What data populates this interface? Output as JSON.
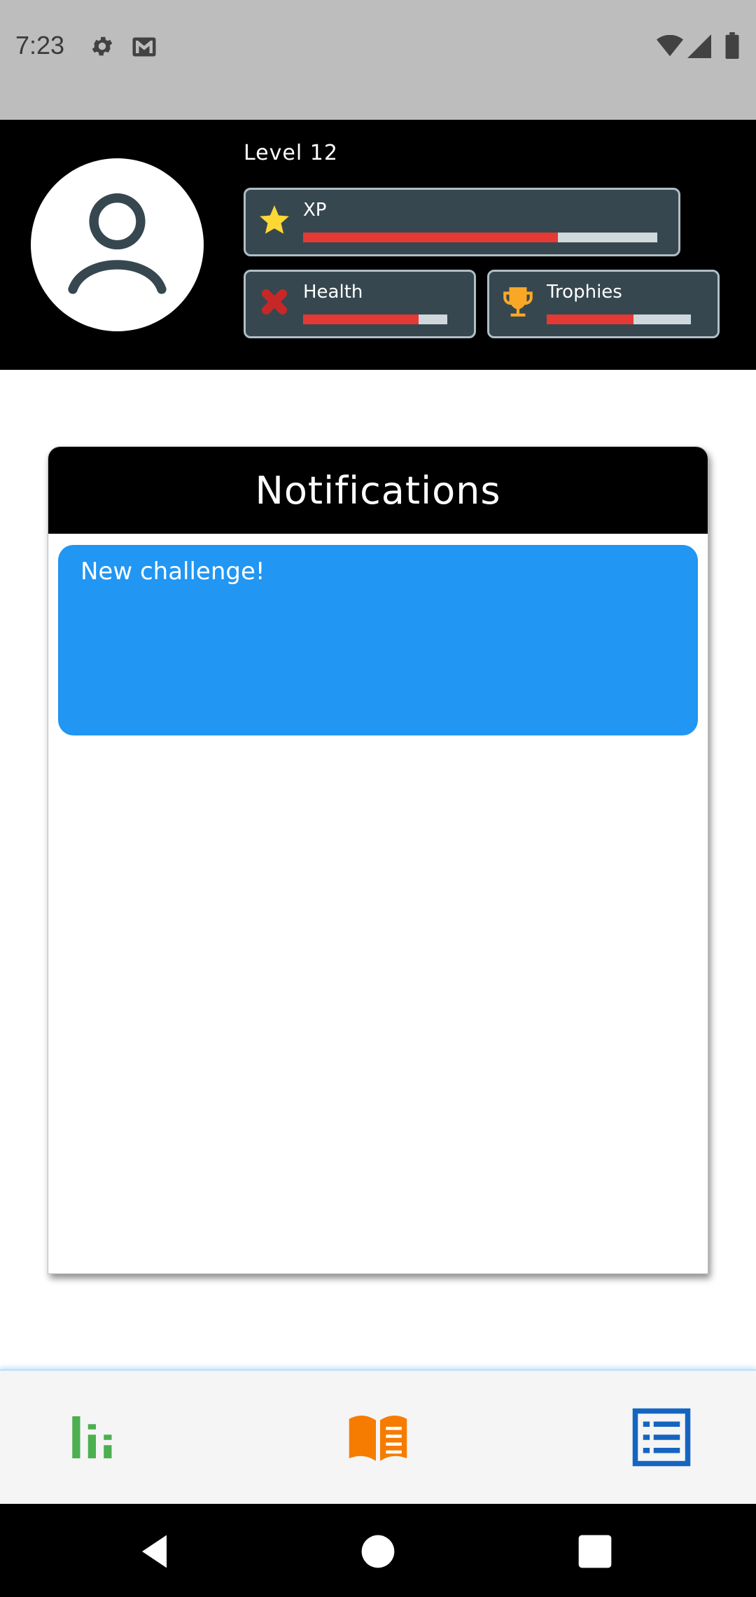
{
  "status_bar": {
    "time": "7:23",
    "icons": [
      "gear-icon",
      "gmail-icon",
      "wifi-icon",
      "signal-icon",
      "battery-icon"
    ]
  },
  "profile": {
    "avatar_icon": "person-icon",
    "level_text": "Level 12",
    "stats": {
      "xp": {
        "label": "XP",
        "icon": "star-icon",
        "fill": 0.72
      },
      "health": {
        "label": "Health",
        "icon": "bandage-icon",
        "fill": 0.8
      },
      "trophies": {
        "label": "Trophies",
        "icon": "trophy-icon",
        "fill": 0.6
      }
    }
  },
  "notifications": {
    "title": "Notifications",
    "items": [
      {
        "text": "New challenge!"
      }
    ]
  },
  "bottom_nav": {
    "items": [
      "stats-chart-icon",
      "book-icon",
      "list-icon"
    ]
  },
  "system_nav": [
    "back-icon",
    "home-icon",
    "recents-icon"
  ],
  "colors": {
    "header": "#000000",
    "stat_card": "#37474f",
    "bar_fill": "#e53935",
    "notification_item": "#2196f3",
    "nav_stats": "#4caf50",
    "nav_book": "#f57c00",
    "nav_list": "#1565c0"
  }
}
